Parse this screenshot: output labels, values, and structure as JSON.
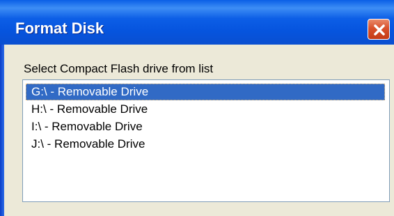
{
  "window": {
    "title": "Format Disk"
  },
  "icons": {
    "close": "close-icon"
  },
  "prompt": {
    "label": "Select Compact Flash drive from list"
  },
  "drive_list": {
    "selected_index": 0,
    "items": [
      "G:\\ - Removable Drive",
      "H:\\ - Removable Drive",
      "I:\\ - Removable Drive",
      "J:\\ - Removable Drive"
    ]
  },
  "colors": {
    "titlebar": "#0c5ee6",
    "close_button": "#d8512c",
    "dialog_face": "#ece9d8",
    "selection": "#316ac5"
  }
}
